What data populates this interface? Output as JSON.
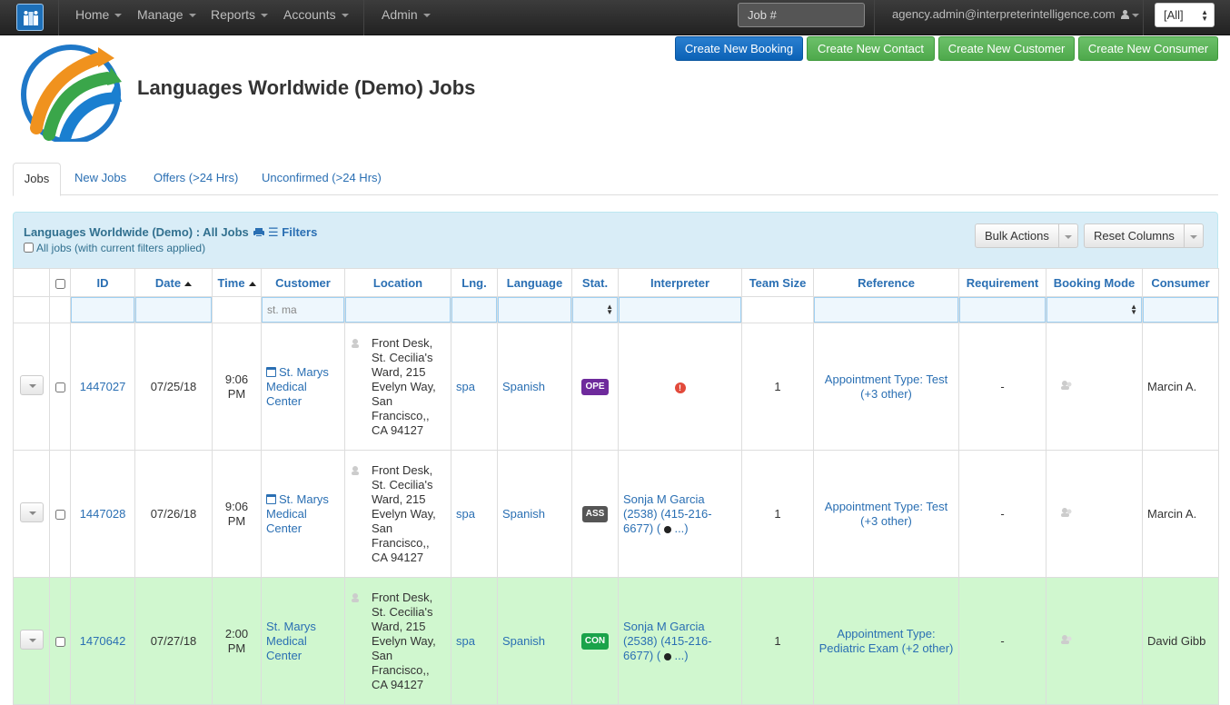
{
  "nav": {
    "items": [
      "Home",
      "Manage",
      "Reports",
      "Accounts",
      "Admin"
    ],
    "job_placeholder": "Job #",
    "user_email": "agency.admin@interpreterintelligence.com",
    "scope_select": "[All]"
  },
  "actions": {
    "create_booking": "Create New Booking",
    "create_contact": "Create New Contact",
    "create_customer": "Create New Customer",
    "create_consumer": "Create New Consumer"
  },
  "page": {
    "title": "Languages Worldwide (Demo) Jobs"
  },
  "tabs": [
    "Jobs",
    "New Jobs",
    "Offers (>24 Hrs)",
    "Unconfirmed (>24 Hrs)"
  ],
  "panel": {
    "title": "Languages Worldwide (Demo) : All Jobs",
    "filters_label": "Filters",
    "all_jobs_label": "All jobs (with current filters applied)",
    "bulk_actions": "Bulk Actions",
    "reset_columns": "Reset Columns"
  },
  "columns": [
    "ID",
    "Date",
    "Time",
    "Customer",
    "Location",
    "Lng.",
    "Language",
    "Stat.",
    "Interpreter",
    "Team Size",
    "Reference",
    "Requirement",
    "Booking Mode",
    "Consumer"
  ],
  "filters": {
    "customer": "st. ma"
  },
  "rows": [
    {
      "id": "1447027",
      "date": "07/25/18",
      "time": "9:06 PM",
      "customer": "St. Marys Medical Center",
      "location": "Front Desk, St. Cecilia's Ward, 215 Evelyn Way, San Francisco,, CA 94127",
      "lng": "spa",
      "language": "Spanish",
      "status": "OPE",
      "interpreter": "",
      "team_size": "1",
      "reference": "Appointment Type: Test (+3 other)",
      "requirement": "-",
      "consumer": "Marcin A."
    },
    {
      "id": "1447028",
      "date": "07/26/18",
      "time": "9:06 PM",
      "customer": "St. Marys Medical Center",
      "location": "Front Desk, St. Cecilia's Ward, 215 Evelyn Way, San Francisco,, CA 94127",
      "lng": "spa",
      "language": "Spanish",
      "status": "ASS",
      "interpreter": "Sonja M Garcia (2538) (415-216-6677) (",
      "interpreter_more": "...)",
      "team_size": "1",
      "reference": "Appointment Type: Test (+3 other)",
      "requirement": "-",
      "consumer": "Marcin A."
    },
    {
      "id": "1470642",
      "date": "07/27/18",
      "time": "2:00 PM",
      "customer": "St. Marys Medical Center",
      "location": "Front Desk, St. Cecilia's Ward, 215 Evelyn Way, San Francisco,, CA 94127",
      "lng": "spa",
      "language": "Spanish",
      "status": "CON",
      "interpreter": "Sonja M Garcia (2538) (415-216-6677) (",
      "interpreter_more": "...)",
      "team_size": "1",
      "reference": "Appointment Type: Pediatric Exam (+2 other)",
      "requirement": "-",
      "consumer": "David Gibb"
    }
  ]
}
